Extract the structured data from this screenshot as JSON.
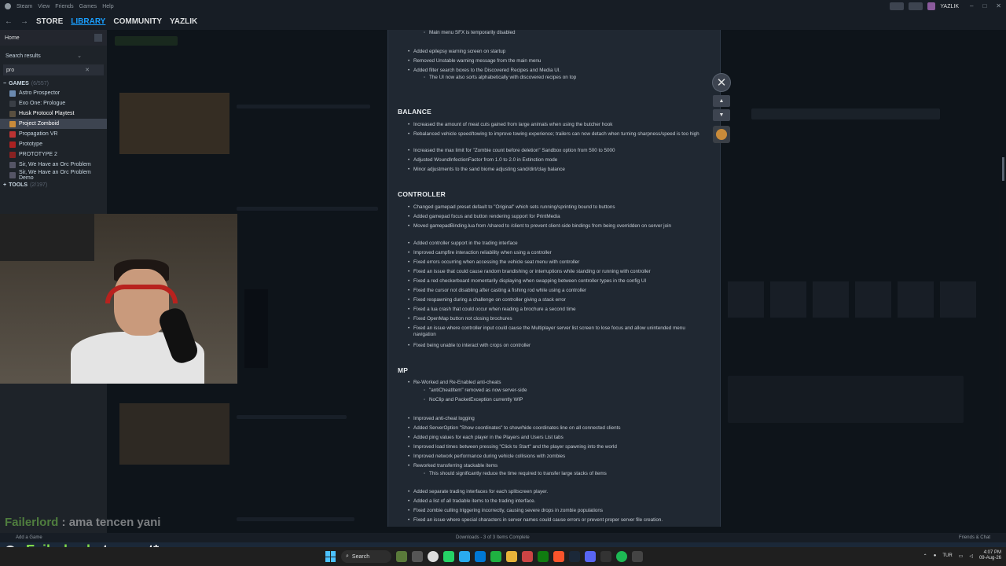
{
  "menubar": {
    "items": [
      "Steam",
      "View",
      "Friends",
      "Games",
      "Help"
    ]
  },
  "nav": {
    "tabs": [
      "STORE",
      "LIBRARY",
      "COMMUNITY",
      "YAZLIK"
    ],
    "active": "LIBRARY",
    "username": "YAZLIK"
  },
  "sidebar": {
    "home": "Home",
    "search_label": "Search results",
    "filter_value": "pro",
    "games_header": "GAMES",
    "games_count": "(6/557)",
    "games": [
      {
        "name": "Astro Prospector",
        "color": "#6b8ab0"
      },
      {
        "name": "Exo One: Prologue",
        "color": "#3a3f46"
      },
      {
        "name": "Husk Protocol Playtest",
        "color": "#5a5040"
      },
      {
        "name": "Project Zomboid",
        "color": "#c98b3a"
      },
      {
        "name": "Propagation VR",
        "color": "#b33"
      },
      {
        "name": "Prototype",
        "color": "#a22"
      },
      {
        "name": "PROTOTYPE 2",
        "color": "#822"
      },
      {
        "name": "Sir, We Have an Orc Problem",
        "color": "#556"
      },
      {
        "name": "Sir, We Have an Orc Problem Demo",
        "color": "#556"
      }
    ],
    "selected": "Project Zomboid",
    "tools_header": "TOOLS",
    "tools_count": "(2/197)"
  },
  "patch_notes": {
    "top_items": [
      {
        "text": "Main menu SFX is temporarily disabled",
        "sub": true
      },
      {
        "text": "Added epilepsy warning screen on startup",
        "sub": false
      },
      {
        "text": "Removed Unstable warning message from the main menu",
        "sub": false
      },
      {
        "text": "Added filter search boxes to the Discovered Recipes and Media UI.",
        "sub": false
      },
      {
        "text": "The UI now also sorts alphabetically with discovered recipes on top",
        "sub": true
      }
    ],
    "balance_title": "BALANCE",
    "balance": [
      "Increased the amount of meat cuts gained from large animals when using the butcher hook",
      "Rebalanced vehicle speed/towing to improve towing experience; trailers can now detach when turning sharpness/speed is too high",
      "Increased the max limit for \"Zombie count before deletion\" Sandbox option from 500 to 5000",
      "Adjusted WoundInfectionFactor from 1.0 to 2.0 in Extinction mode",
      "Minor adjustments to the sand biome adjusting sand/dirt/clay balance"
    ],
    "controller_title": "CONTROLLER",
    "controller": [
      "Changed gamepad preset default to \"Original\" which sets running/sprinting bound to buttons",
      "Added gamepad focus and button rendering support for PrintMedia",
      "Moved gamepadBinding.lua from /shared to /client to prevent client-side bindings from being overridden on server join",
      "Added controller support in the trading interface",
      "Improved campfire interaction reliability when using a controller",
      "Fixed errors occurring when accessing the vehicle seat menu with controller",
      "Fixed an issue that could cause random brandishing or interruptions while standing or running with controller",
      "Fixed a red checkerboard momentarily displaying when swapping between controller types in the config UI",
      "Fixed the cursor not disabling after casting a fishing rod while using a controller",
      "Fixed respawning during a challenge on controller giving a stack error",
      "Fixed a lua crash that could occur when reading a brochure a second time",
      "Fixed OpenMap button not closing brochures",
      "Fixed an issue where controller input could cause the Multiplayer server list screen to lose focus and allow unintended menu navigation",
      "Fixed being unable to interact with crops on controller"
    ],
    "mp_title": "MP",
    "mp": [
      {
        "text": "Re-Worked and Re-Enabled anti-cheats",
        "sub": false
      },
      {
        "text": "\"antiCheatItem\" removed as now server-side",
        "sub": true
      },
      {
        "text": "NoClip and PacketException currently WIP",
        "sub": true
      },
      {
        "text": "Improved anti-cheat logging",
        "sub": false
      },
      {
        "text": "Added ServerOption \"Show coordinates\" to show/hide coordinates line on all connected clients",
        "sub": false
      },
      {
        "text": "Added ping values for each player in the Players and Users List tabs",
        "sub": false
      },
      {
        "text": "Improved load times between pressing \"Click to Start\" and the player spawning into the world",
        "sub": false
      },
      {
        "text": "Improved network performance during vehicle collisions with zombies",
        "sub": false
      },
      {
        "text": "Reworked transferring stackable items",
        "sub": false
      },
      {
        "text": "This should significantly reduce the time required to transfer large stacks of items",
        "sub": true
      },
      {
        "text": "Added separate trading interfaces for each splitscreen player.",
        "sub": false
      },
      {
        "text": "Added a list of all tradable items to the trading interface.",
        "sub": false
      },
      {
        "text": "Fixed zombie culling triggering incorrectly, causing severe drops in zombie populations",
        "sub": false
      },
      {
        "text": "Fixed an issue where special characters in server names could cause errors or prevent proper server file creation.",
        "sub": false
      }
    ]
  },
  "chat": [
    {
      "user": "Failerlord",
      "message": ": ama tencen yani"
    },
    {
      "user": "Failerlord",
      "message": ": tencent*"
    }
  ],
  "bottombar": {
    "add_game": "Add a Game",
    "downloads": "Downloads - 3 of 3 Items Complete",
    "friends": "Friends & Chat"
  },
  "taskbar": {
    "search": "Search",
    "lang": "TUR",
    "time": "4:07 PM",
    "date": "09-Aug-26"
  },
  "icons": [
    "close-icon",
    "chevron-up-icon",
    "chevron-down-icon",
    "search-icon",
    "windows-start-icon"
  ],
  "colors": {
    "accent": "#1a9fff",
    "chat_user": "#7fd94a",
    "modal_bg": "#202832"
  }
}
